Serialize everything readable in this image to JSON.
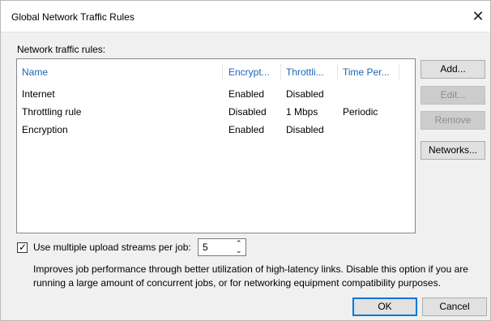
{
  "window": {
    "title": "Global Network Traffic Rules",
    "close_glyph": "✕"
  },
  "rules": {
    "label": "Network traffic rules:",
    "columns": [
      "Name",
      "Encrypt...",
      "Throttli...",
      "Time Per..."
    ],
    "rows": [
      [
        "Internet",
        "Enabled",
        "Disabled",
        ""
      ],
      [
        "Throttling rule",
        "Disabled",
        "1 Mbps",
        "Periodic"
      ],
      [
        "Encryption",
        "Enabled",
        "Disabled",
        ""
      ]
    ]
  },
  "buttons": {
    "add": "Add...",
    "edit": "Edit...",
    "remove": "Remove",
    "networks": "Networks...",
    "ok": "OK",
    "cancel": "Cancel"
  },
  "streams": {
    "checkbox_label": "Use multiple upload streams per job:",
    "checked": true,
    "check_glyph": "✓",
    "value": "5",
    "up_glyph": "⌃",
    "down_glyph": "⌄",
    "description": "Improves job performance through better utilization of high-latency links. Disable this option if you are running a large amount of concurrent jobs, or for networking equipment compatibility purposes."
  },
  "colors": {
    "header_text": "#1e64b4",
    "default_button_border": "#0078d7",
    "dialog_background": "#f0f0f0"
  }
}
